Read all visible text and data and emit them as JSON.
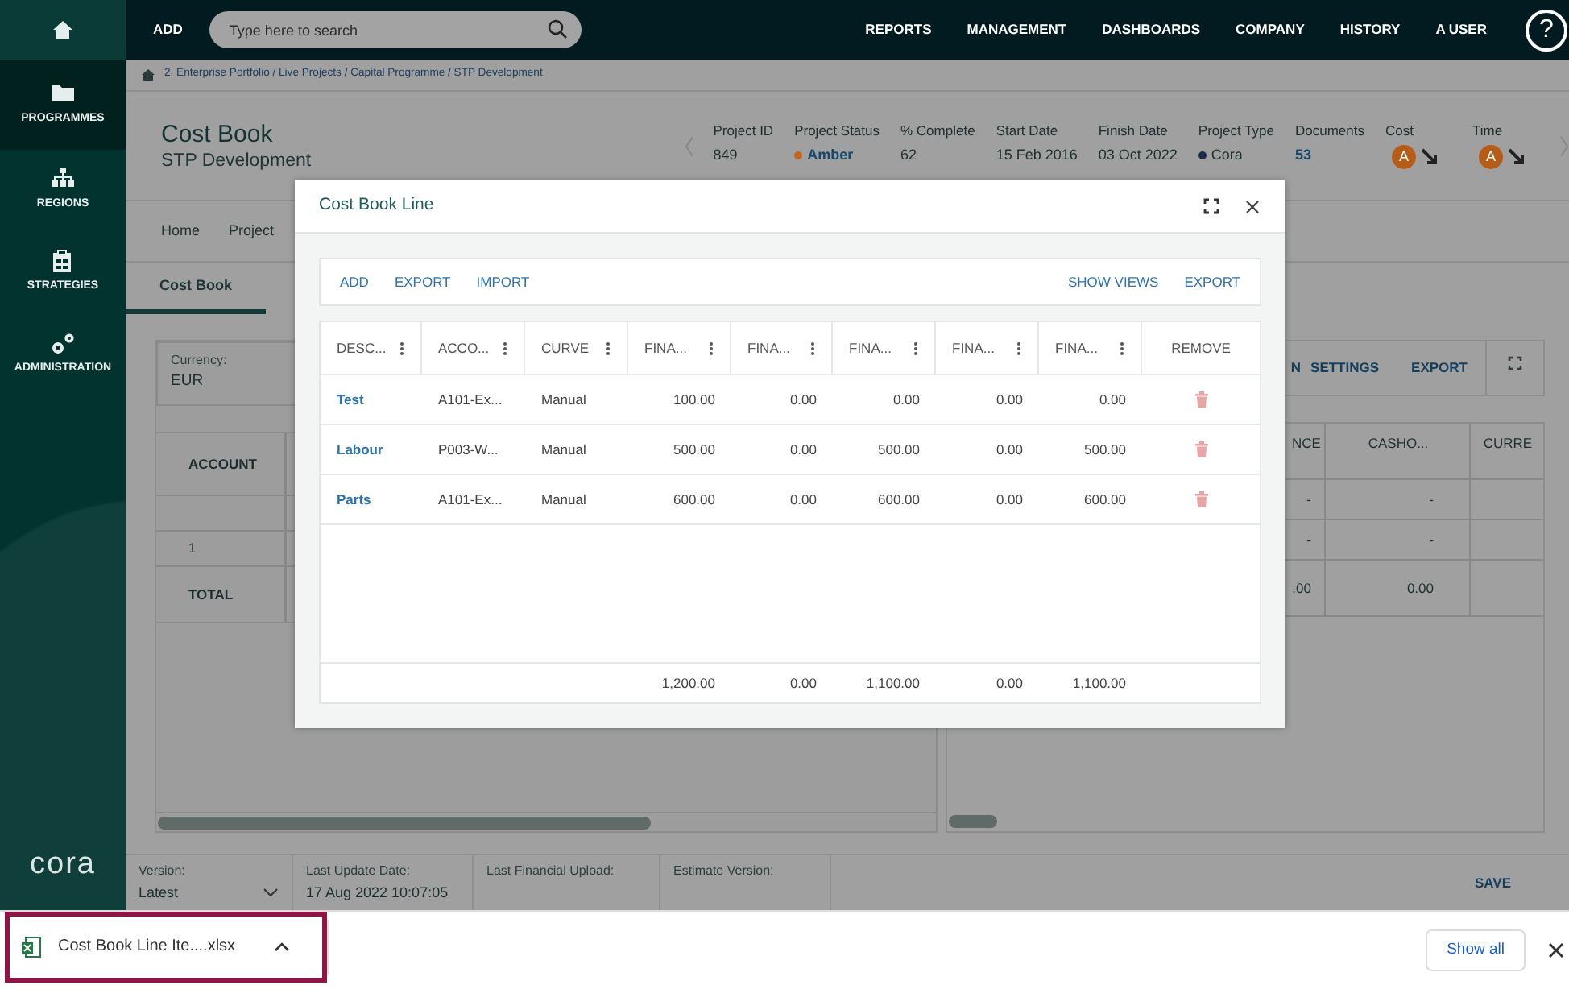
{
  "topbar": {
    "add": "ADD",
    "search": {
      "placeholder": "Type here to search"
    },
    "menu": [
      "REPORTS",
      "MANAGEMENT",
      "DASHBOARDS",
      "COMPANY",
      "HISTORY",
      "A USER"
    ],
    "help": "?"
  },
  "sidebar": {
    "items": [
      {
        "label": "PROGRAMMES",
        "kind": "folder",
        "selected": true
      },
      {
        "label": "REGIONS",
        "kind": "org",
        "selected": false
      },
      {
        "label": "STRATEGIES",
        "kind": "clipboard",
        "selected": false
      },
      {
        "label": "ADMINISTRATION",
        "kind": "gears",
        "selected": false
      }
    ],
    "logo": "cora"
  },
  "breadcrumb": "2. Enterprise Portfolio / Live Projects / Capital Programme / STP Development",
  "header": {
    "title": "Cost Book",
    "subtitle": "STP Development",
    "fields": [
      {
        "label": "Project ID",
        "value": "849",
        "kind": "text"
      },
      {
        "label": "Project Status",
        "value": "Amber",
        "kind": "status",
        "color": "#c2661c"
      },
      {
        "label": "% Complete",
        "value": "62",
        "kind": "text"
      },
      {
        "label": "Start Date",
        "value": "15 Feb 2016",
        "kind": "text"
      },
      {
        "label": "Finish Date",
        "value": "03 Oct 2022",
        "kind": "text"
      },
      {
        "label": "Project Type",
        "value": "Cora",
        "kind": "dot",
        "color": "#1c2c4c"
      },
      {
        "label": "Documents",
        "value": "53",
        "kind": "link"
      },
      {
        "label": "Cost",
        "value": "A",
        "kind": "rag"
      },
      {
        "label": "Time",
        "value": "A",
        "kind": "rag"
      }
    ]
  },
  "tabs": [
    {
      "label": "Home",
      "selected": false
    },
    {
      "label": "Project",
      "selected": false
    }
  ],
  "subtabs": [
    {
      "label": "Cost Book",
      "selected": true
    }
  ],
  "left_panel": {
    "currency": {
      "label": "Currency:",
      "value": "EUR"
    },
    "column": "ACCOUNT",
    "rows": [
      "1"
    ],
    "total": "TOTAL"
  },
  "right_panel": {
    "toolbar": [
      "N",
      "SETTINGS",
      "EXPORT"
    ],
    "columns": [
      "NCE",
      "CASHO...",
      "CURRE"
    ],
    "rows": [
      [
        "-",
        "-"
      ],
      [
        "-",
        "-"
      ]
    ],
    "totals": [
      ".00",
      "0.00"
    ]
  },
  "footer": {
    "fields": [
      {
        "label": "Version:",
        "value": "Latest",
        "kind": "select"
      },
      {
        "label": "Last Update Date:",
        "value": "17 Aug 2022 10:07:05",
        "kind": "text"
      },
      {
        "label": "Last Financial Upload:",
        "kind": "text"
      },
      {
        "label": "Estimate Version:",
        "kind": "text"
      }
    ],
    "save": "SAVE"
  },
  "modal": {
    "title": "Cost Book Line",
    "toolbar_left": [
      "ADD",
      "EXPORT",
      "IMPORT"
    ],
    "toolbar_right": [
      "SHOW VIEWS",
      "EXPORT"
    ],
    "columns": [
      {
        "label": "DESC...",
        "kind": "data"
      },
      {
        "label": "ACCO...",
        "kind": "data"
      },
      {
        "label": "CURVE",
        "kind": "data"
      },
      {
        "label": "FINA...",
        "kind": "data"
      },
      {
        "label": "FINA...",
        "kind": "data"
      },
      {
        "label": "FINA...",
        "kind": "data"
      },
      {
        "label": "FINA...",
        "kind": "data"
      },
      {
        "label": "FINA...",
        "kind": "data"
      },
      {
        "label": "REMOVE",
        "kind": "action"
      }
    ],
    "rows": [
      {
        "description": "Test",
        "account": "A101-Ex...",
        "curve": "Manual",
        "values": [
          "100.00",
          "0.00",
          "0.00",
          "0.00",
          "0.00"
        ]
      },
      {
        "description": "Labour",
        "account": "P003-W...",
        "curve": "Manual",
        "values": [
          "500.00",
          "0.00",
          "500.00",
          "0.00",
          "500.00"
        ]
      },
      {
        "description": "Parts",
        "account": "A101-Ex...",
        "curve": "Manual",
        "values": [
          "600.00",
          "0.00",
          "600.00",
          "0.00",
          "600.00"
        ]
      }
    ],
    "totals": [
      "1,200.00",
      "0.00",
      "1,100.00",
      "0.00",
      "1,100.00"
    ]
  },
  "download_bar": {
    "file": "Cost Book Line Ite....xlsx",
    "show_all": "Show all",
    "highlighted": true
  }
}
